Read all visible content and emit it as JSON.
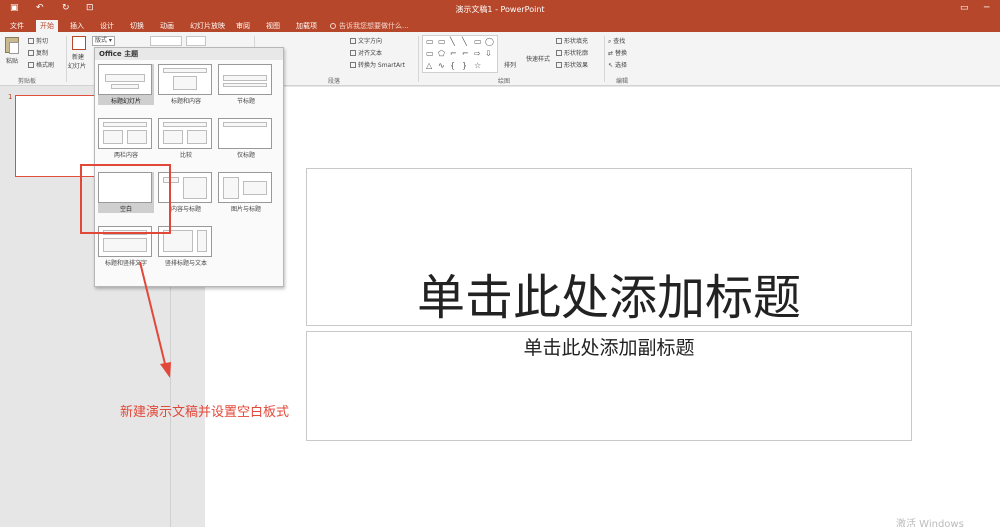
{
  "window": {
    "title": "演示文稿1 - PowerPoint"
  },
  "tabs": [
    {
      "label": "文件"
    },
    {
      "label": "开始",
      "active": true
    },
    {
      "label": "插入"
    },
    {
      "label": "设计"
    },
    {
      "label": "切换"
    },
    {
      "label": "动画"
    },
    {
      "label": "幻灯片放映"
    },
    {
      "label": "审阅"
    },
    {
      "label": "视图"
    },
    {
      "label": "加载项"
    }
  ],
  "tell_me": "告诉我您想要做什么...",
  "ribbon": {
    "paste_label": "粘贴",
    "cut_label": "剪切",
    "copy_label": "复制",
    "format_painter_label": "格式刷",
    "clipboard_group": "剪贴板",
    "new_slide_label": "新建",
    "new_slide_label2": "幻灯片",
    "layout_button": "版式",
    "text_direction": "文字方向",
    "align_text": "对齐文本",
    "convert_smartart": "转换为 SmartArt",
    "paragraph_group": "段落",
    "arrange_label": "排列",
    "quick_styles_label": "快速样式",
    "shape_fill": "形状填充",
    "shape_outline": "形状轮廓",
    "shape_effects": "形状效果",
    "drawing_group": "绘图",
    "find_label": "查找",
    "replace_label": "替换",
    "select_label": "选择",
    "editing_group": "编辑"
  },
  "gallery": {
    "header": "Office 主题",
    "layouts": [
      {
        "label": "标题幻灯片"
      },
      {
        "label": "标题和内容"
      },
      {
        "label": "节标题"
      },
      {
        "label": "两栏内容"
      },
      {
        "label": "比较"
      },
      {
        "label": "仅标题"
      },
      {
        "label": "空白",
        "selected": true
      },
      {
        "label": "内容与标题"
      },
      {
        "label": "图片与标题"
      },
      {
        "label": "标题和竖排文字"
      },
      {
        "label": "竖排标题与文本"
      }
    ]
  },
  "thumbnail": {
    "number": "1"
  },
  "slide": {
    "title_placeholder": "单击此处添加标题",
    "subtitle_placeholder": "单击此处添加副标题"
  },
  "annotation": {
    "text": "新建演示文稿并设置空白板式",
    "color": "#e2483a"
  },
  "watermark": "激活 Windows",
  "colors": {
    "accent": "#b7472a"
  }
}
